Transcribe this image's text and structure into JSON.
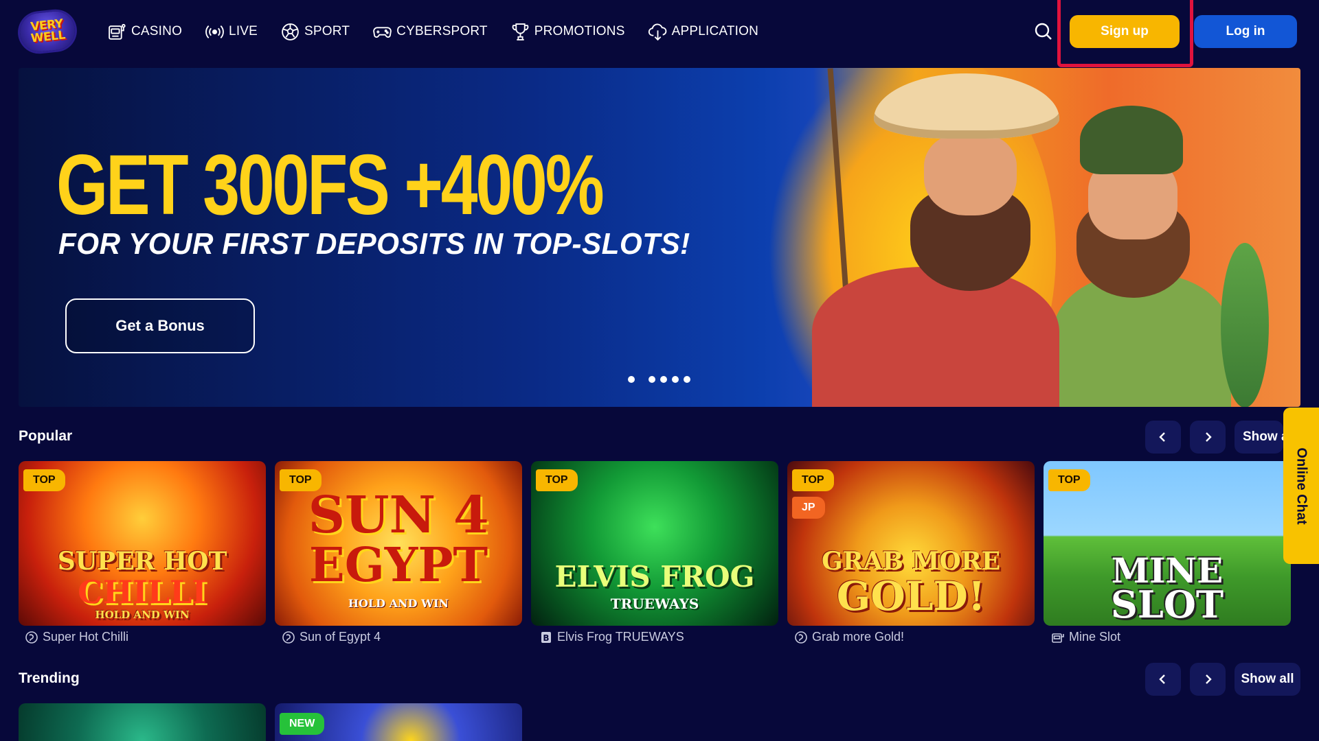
{
  "header": {
    "logo_text": [
      "VERY",
      "WELL"
    ],
    "nav": [
      {
        "label": "CASINO",
        "icon": "slot-machine-icon"
      },
      {
        "label": "LIVE",
        "icon": "broadcast-icon"
      },
      {
        "label": "SPORT",
        "icon": "soccer-ball-icon"
      },
      {
        "label": "CYBERSPORT",
        "icon": "gamepad-icon"
      },
      {
        "label": "PROMOTIONS",
        "icon": "trophy-icon"
      },
      {
        "label": "APPLICATION",
        "icon": "download-cloud-icon"
      }
    ],
    "search_icon": "search-icon",
    "signup_label": "Sign up",
    "login_label": "Log in"
  },
  "banner": {
    "title": "GET 300FS +400%",
    "subtitle": "FOR YOUR FIRST DEPOSITS IN TOP-SLOTS!",
    "cta_label": "Get a Bonus",
    "slide_count": 5,
    "active_slide": 1
  },
  "popular": {
    "title": "Popular",
    "show_all_label": "Show all",
    "games": [
      {
        "name": "Super Hot Chilli",
        "badges": [
          "TOP"
        ],
        "art_title": [
          "SUPER HOT",
          "CHILLI",
          "HOLD AND WIN"
        ],
        "provider_icon": "provider-spiral-icon"
      },
      {
        "name": "Sun of Egypt 4",
        "badges": [
          "TOP"
        ],
        "art_title": [
          "SUN 4",
          "EGYPT",
          "HOLD AND WIN"
        ],
        "provider_icon": "provider-spiral-icon"
      },
      {
        "name": "Elvis Frog TRUEWAYS",
        "badges": [
          "TOP"
        ],
        "art_title": [
          "ELVIS FROG",
          "TRUEWAYS"
        ],
        "provider_icon": "provider-b-icon"
      },
      {
        "name": "Grab more Gold!",
        "badges": [
          "TOP",
          "JP"
        ],
        "art_title": [
          "GRAB MORE",
          "GOLD!"
        ],
        "provider_icon": "provider-spiral-icon"
      },
      {
        "name": "Mine Slot",
        "badges": [
          "TOP"
        ],
        "art_title": [
          "MINE",
          "SLOT"
        ],
        "provider_icon": "provider-slot-icon"
      }
    ]
  },
  "trending": {
    "title": "Trending",
    "show_all_label": "Show all",
    "games": [
      {
        "badges": []
      },
      {
        "badges": [
          "NEW"
        ]
      }
    ]
  },
  "online_chat_label": "Online Chat",
  "colors": {
    "background": "#07083a",
    "accent_yellow": "#f8b600",
    "login_blue": "#1256d6",
    "highlight_red": "#e0133d",
    "button_dark": "#13175a"
  }
}
